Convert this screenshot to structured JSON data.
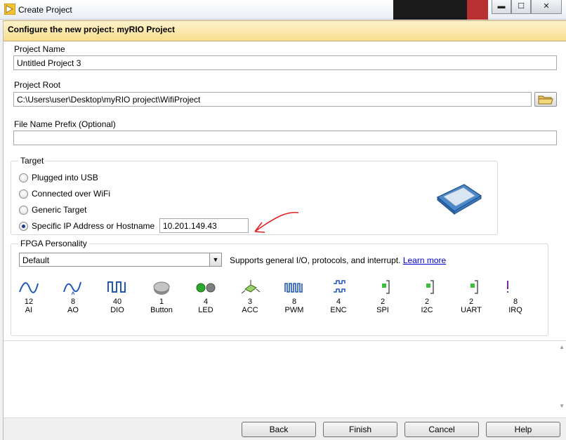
{
  "window": {
    "title": "Create Project",
    "minimize": "▬",
    "maximize": "☐",
    "close": "✕"
  },
  "header": {
    "title": "Configure the new project: myRIO Project"
  },
  "form": {
    "project_name_label": "Project Name",
    "project_name_value": "Untitled Project 3",
    "project_root_label": "Project Root",
    "project_root_value": "C:\\Users\\user\\Desktop\\myRIO project\\WifiProject",
    "prefix_label": "File Name Prefix (Optional)",
    "prefix_value": ""
  },
  "target": {
    "legend": "Target",
    "options": [
      {
        "label": "Plugged into USB",
        "checked": false
      },
      {
        "label": "Connected over WiFi",
        "checked": false
      },
      {
        "label": "Generic Target",
        "checked": false
      },
      {
        "label": "Specific IP Address or Hostname",
        "checked": true
      }
    ],
    "ip_value": "10.201.149.43"
  },
  "fpga": {
    "legend": "FPGA Personality",
    "selected": "Default",
    "description": "Supports general I/O, protocols, and interrupt.",
    "learn_more": "Learn more",
    "resources": [
      {
        "count": "12",
        "name": "AI",
        "icon": "ai-icon"
      },
      {
        "count": "8",
        "name": "AO",
        "icon": "ao-icon"
      },
      {
        "count": "40",
        "name": "DIO",
        "icon": "dio-icon"
      },
      {
        "count": "1",
        "name": "Button",
        "icon": "button-icon"
      },
      {
        "count": "4",
        "name": "LED",
        "icon": "led-icon"
      },
      {
        "count": "3",
        "name": "ACC",
        "icon": "accelerometer-icon"
      },
      {
        "count": "8",
        "name": "PWM",
        "icon": "pwm-icon"
      },
      {
        "count": "4",
        "name": "ENC",
        "icon": "encoder-icon"
      },
      {
        "count": "2",
        "name": "SPI",
        "icon": "spi-icon"
      },
      {
        "count": "2",
        "name": "I2C",
        "icon": "i2c-icon"
      },
      {
        "count": "2",
        "name": "UART",
        "icon": "uart-icon"
      },
      {
        "count": "8",
        "name": "IRQ",
        "icon": "irq-icon"
      }
    ]
  },
  "footer": {
    "back": "Back",
    "finish": "Finish",
    "cancel": "Cancel",
    "help": "Help"
  },
  "colors": {
    "header_bg": "#f7dd8e",
    "annotation_arrow": "#e02020",
    "link": "#0000cc"
  }
}
